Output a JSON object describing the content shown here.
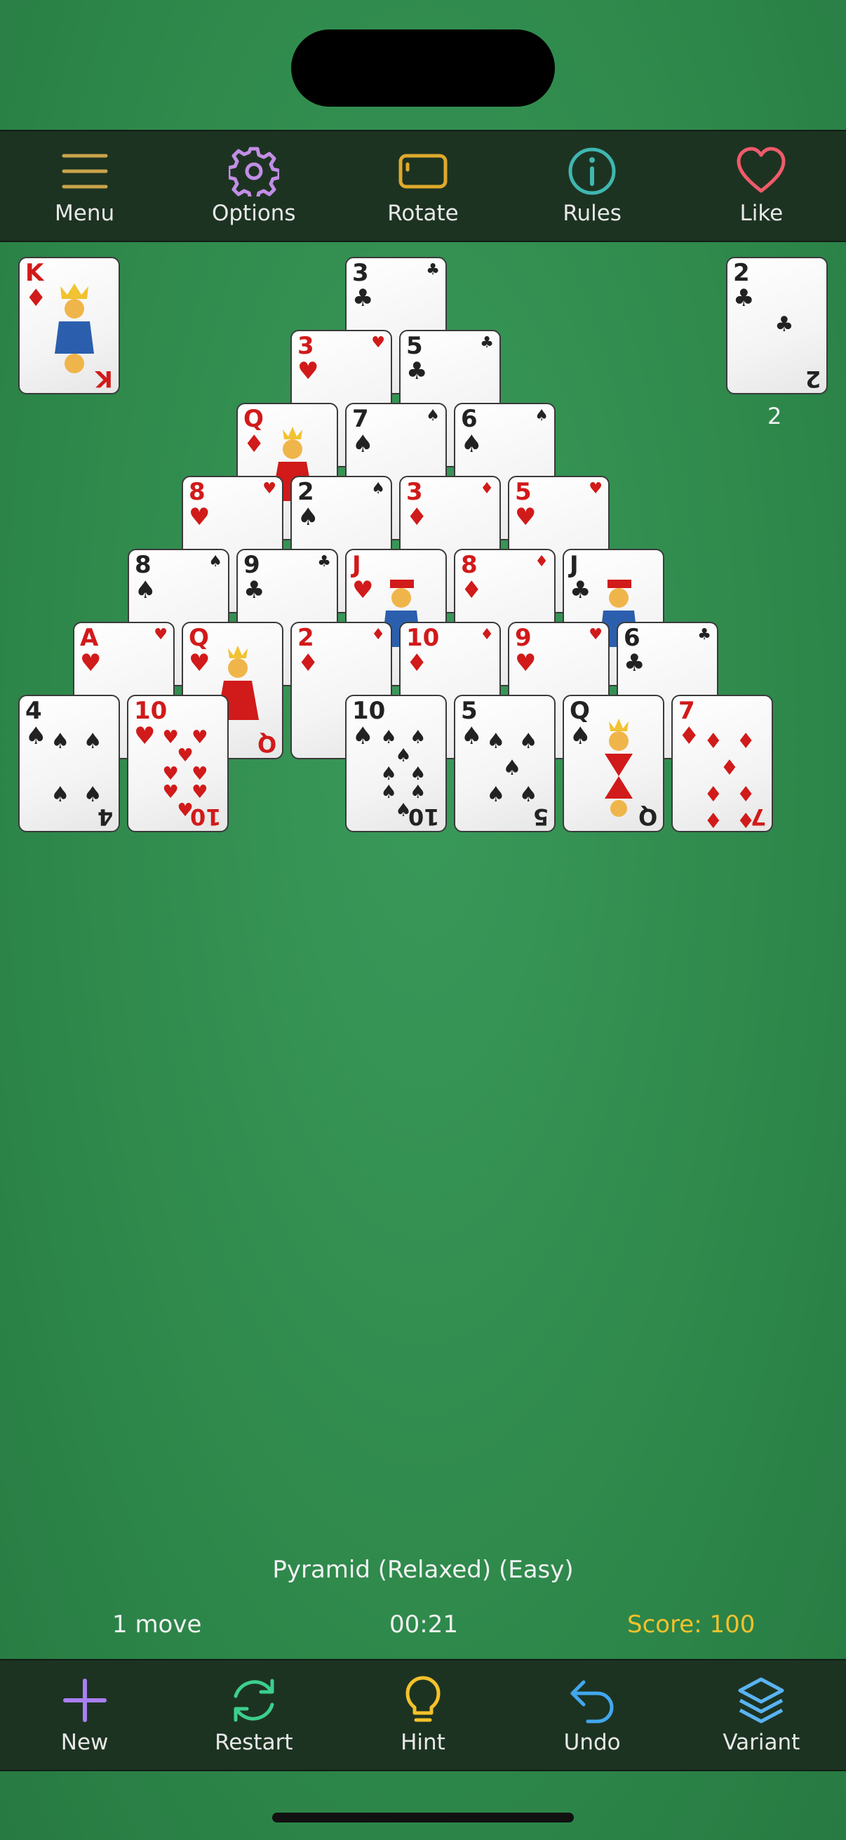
{
  "top_toolbar": {
    "menu": "Menu",
    "options": "Options",
    "rotate": "Rotate",
    "rules": "Rules",
    "like": "Like"
  },
  "bottom_toolbar": {
    "new": "New",
    "restart": "Restart",
    "hint": "Hint",
    "undo": "Undo",
    "variant": "Variant"
  },
  "colors": {
    "menu_icon": "#c9a34a",
    "options_icon": "#c38ee6",
    "rotate_icon": "#e0a92c",
    "rules_icon": "#3fb7b0",
    "like_icon": "#ef5b6a",
    "new_icon": "#a97ff2",
    "restart_icon": "#3ccf8e",
    "hint_icon": "#f4c22b",
    "undo_icon": "#42a7f0",
    "variant_icon": "#5ab3f2",
    "score": "#f4c22b"
  },
  "foundation": {
    "rank": "K",
    "suit": "♦"
  },
  "waste": {
    "rank": "2",
    "suit": "♣",
    "count": "2"
  },
  "pyramid": {
    "r0": [
      {
        "rank": "3",
        "suit": "♣"
      }
    ],
    "r1": [
      {
        "rank": "3",
        "suit": "♥"
      },
      {
        "rank": "5",
        "suit": "♣"
      }
    ],
    "r2": [
      {
        "rank": "Q",
        "suit": "♦"
      },
      {
        "rank": "7",
        "suit": "♠"
      },
      {
        "rank": "6",
        "suit": "♠"
      }
    ],
    "r3": [
      {
        "rank": "8",
        "suit": "♥"
      },
      {
        "rank": "2",
        "suit": "♠"
      },
      {
        "rank": "3",
        "suit": "♦"
      },
      {
        "rank": "5",
        "suit": "♥"
      }
    ],
    "r4": [
      {
        "rank": "8",
        "suit": "♠"
      },
      {
        "rank": "9",
        "suit": "♣"
      },
      {
        "rank": "J",
        "suit": "♥"
      },
      {
        "rank": "8",
        "suit": "♦"
      },
      {
        "rank": "J",
        "suit": "♣"
      }
    ],
    "r5": [
      {
        "rank": "A",
        "suit": "♥"
      },
      {
        "rank": "Q",
        "suit": "♥"
      },
      {
        "rank": "2",
        "suit": "♦"
      },
      {
        "rank": "10",
        "suit": "♦"
      },
      {
        "rank": "9",
        "suit": "♥"
      },
      {
        "rank": "6",
        "suit": "♣"
      }
    ],
    "r6": [
      {
        "rank": "4",
        "suit": "♠"
      },
      {
        "rank": "10",
        "suit": "♥"
      },
      {
        "rank": "10",
        "suit": "♠"
      },
      {
        "rank": "5",
        "suit": "♠"
      },
      {
        "rank": "Q",
        "suit": "♠"
      },
      {
        "rank": "7",
        "suit": "♦"
      }
    ]
  },
  "status": {
    "game_name": "Pyramid (Relaxed) (Easy)",
    "moves": "1 move",
    "time": "00:21",
    "score": "Score: 100"
  }
}
